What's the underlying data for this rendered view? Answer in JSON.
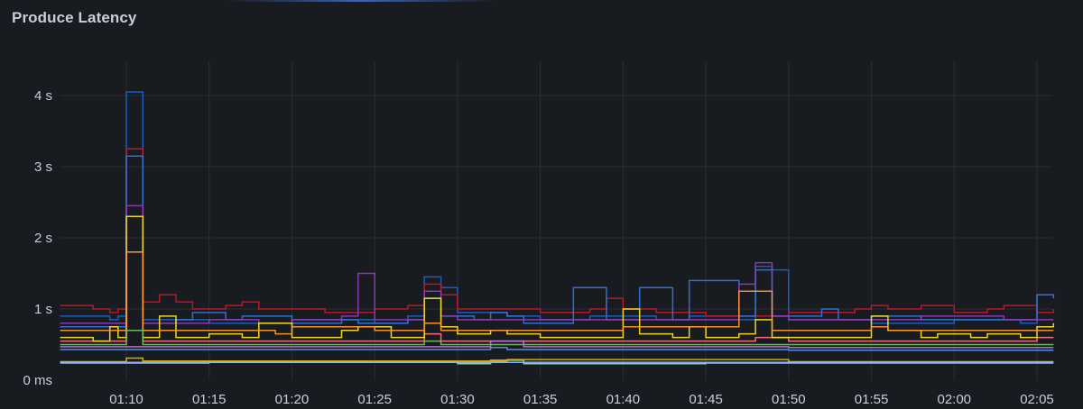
{
  "panel": {
    "title": "Produce Latency"
  },
  "chart_data": {
    "type": "line",
    "title": "Produce Latency",
    "xlabel": "",
    "ylabel": "",
    "x_unit": "time (HH:MM)",
    "y_unit": "seconds",
    "xlim": [
      "01:06",
      "02:06"
    ],
    "ylim": [
      0,
      4.2
    ],
    "x_ticks": [
      "01:10",
      "01:15",
      "01:20",
      "01:25",
      "01:30",
      "01:35",
      "01:40",
      "01:45",
      "01:50",
      "01:55",
      "02:00",
      "02:05"
    ],
    "y_ticks": [
      {
        "value": 0,
        "label": "0 ms"
      },
      {
        "value": 1,
        "label": "1 s"
      },
      {
        "value": 2,
        "label": "2 s"
      },
      {
        "value": 3,
        "label": "3 s"
      },
      {
        "value": 4,
        "label": "4 s"
      }
    ],
    "grid": true,
    "legend": "none",
    "series": [
      {
        "color": "#1f60c4",
        "x": [
          "01:06",
          "01:09",
          "01:09:30",
          "01:10",
          "01:10:30",
          "01:11",
          "01:15",
          "01:20",
          "01:25",
          "01:27",
          "01:28",
          "01:29",
          "01:30",
          "01:33",
          "01:34",
          "01:35",
          "01:37",
          "01:38",
          "01:39",
          "01:42",
          "01:43",
          "01:44",
          "01:47",
          "01:48",
          "01:49",
          "01:50",
          "01:55",
          "02:00",
          "02:04",
          "02:05",
          "02:06"
        ],
        "y": [
          0.9,
          0.85,
          0.9,
          4.05,
          4.05,
          0.85,
          0.8,
          0.85,
          0.8,
          0.9,
          1.45,
          1.3,
          0.95,
          0.9,
          0.9,
          0.85,
          0.85,
          0.9,
          0.9,
          0.85,
          0.85,
          0.9,
          0.85,
          1.6,
          1.55,
          0.85,
          0.8,
          0.85,
          0.8,
          1.2,
          1.15
        ]
      },
      {
        "color": "#c4162a",
        "x": [
          "01:06",
          "01:08",
          "01:09",
          "01:09:30",
          "01:10",
          "01:10:30",
          "01:11",
          "01:12",
          "01:13",
          "01:14",
          "01:16",
          "01:17",
          "01:18",
          "01:22",
          "01:25",
          "01:27",
          "01:28",
          "01:29",
          "01:30",
          "01:35",
          "01:38",
          "01:39",
          "01:40",
          "01:42",
          "01:45",
          "01:50",
          "01:54",
          "01:55",
          "01:56",
          "01:58",
          "02:00",
          "02:02",
          "02:03",
          "02:05",
          "02:06"
        ],
        "y": [
          1.05,
          1.0,
          0.95,
          1.0,
          3.25,
          3.25,
          1.1,
          1.2,
          1.1,
          1.0,
          1.05,
          1.1,
          1.0,
          0.95,
          1.0,
          1.05,
          1.35,
          1.2,
          1.0,
          0.95,
          1.0,
          1.15,
          1.0,
          0.95,
          0.9,
          0.95,
          1.0,
          1.05,
          1.0,
          1.05,
          0.95,
          1.0,
          1.05,
          0.95,
          1.0
        ]
      },
      {
        "color": "#3274d9",
        "x": [
          "01:06",
          "01:09:30",
          "01:10",
          "01:10:30",
          "01:11",
          "01:13",
          "01:14",
          "01:16",
          "01:17",
          "01:20",
          "01:23",
          "01:24",
          "01:27",
          "01:28",
          "01:29",
          "01:31",
          "01:32",
          "01:33",
          "01:34",
          "01:35",
          "01:37",
          "01:38",
          "01:39",
          "01:41",
          "01:42",
          "01:43",
          "01:44",
          "01:45",
          "01:47",
          "01:48",
          "01:49",
          "01:52",
          "01:53",
          "01:55",
          "01:58",
          "02:00",
          "02:04",
          "02:05",
          "02:06"
        ],
        "y": [
          0.75,
          0.75,
          3.15,
          3.15,
          0.8,
          0.85,
          0.95,
          0.85,
          0.9,
          0.8,
          0.85,
          0.8,
          0.85,
          1.15,
          0.9,
          0.85,
          0.95,
          0.9,
          0.8,
          0.8,
          1.3,
          1.3,
          0.85,
          1.3,
          1.3,
          0.85,
          1.4,
          1.4,
          0.9,
          1.55,
          0.9,
          1.0,
          0.85,
          0.9,
          0.85,
          0.85,
          0.85,
          1.2,
          1.15
        ]
      },
      {
        "color": "#8f3bb8",
        "x": [
          "01:06",
          "01:09:30",
          "01:10",
          "01:10:30",
          "01:11",
          "01:15",
          "01:18",
          "01:20",
          "01:23",
          "01:24",
          "01:25",
          "01:27",
          "01:28",
          "01:29",
          "01:30",
          "01:33",
          "01:35",
          "01:40",
          "01:45",
          "01:47",
          "01:48",
          "01:49",
          "01:50",
          "01:55",
          "01:58",
          "02:00",
          "02:03",
          "02:04",
          "02:05",
          "02:06"
        ],
        "y": [
          0.8,
          0.8,
          2.45,
          2.45,
          0.8,
          0.85,
          0.8,
          0.85,
          0.9,
          1.5,
          0.85,
          0.85,
          1.25,
          0.9,
          0.85,
          0.85,
          0.85,
          0.85,
          0.85,
          1.35,
          1.65,
          0.9,
          0.85,
          0.85,
          0.9,
          0.9,
          0.85,
          0.85,
          0.85,
          0.85
        ]
      },
      {
        "color": "#ff7383",
        "x": [
          "01:06",
          "01:09:30",
          "01:10",
          "01:10:30",
          "01:11",
          "01:20",
          "01:28",
          "01:29",
          "01:33",
          "01:40",
          "01:48",
          "01:50",
          "02:05",
          "02:06"
        ],
        "y": [
          0.55,
          0.55,
          1.8,
          1.8,
          0.55,
          0.55,
          0.65,
          0.55,
          0.55,
          0.55,
          0.6,
          0.55,
          0.6,
          0.6
        ]
      },
      {
        "color": "#fade2a",
        "x": [
          "01:06",
          "01:08",
          "01:09",
          "01:09:30",
          "01:10",
          "01:10:30",
          "01:11",
          "01:12",
          "01:13",
          "01:14",
          "01:15",
          "01:17",
          "01:18",
          "01:20",
          "01:22",
          "01:23",
          "01:24",
          "01:26",
          "01:27",
          "01:28",
          "01:29",
          "01:30",
          "01:32",
          "01:33",
          "01:35",
          "01:39",
          "01:40",
          "01:41",
          "01:43",
          "01:44",
          "01:45",
          "01:47",
          "01:48",
          "01:49",
          "01:52",
          "01:54",
          "01:55",
          "01:56",
          "01:58",
          "01:59",
          "02:01",
          "02:02",
          "02:04",
          "02:05",
          "02:06"
        ],
        "y": [
          0.6,
          0.55,
          0.75,
          0.6,
          2.3,
          2.3,
          0.6,
          0.9,
          0.6,
          0.6,
          0.65,
          0.6,
          0.8,
          0.6,
          0.6,
          0.7,
          0.75,
          0.6,
          0.6,
          1.15,
          0.75,
          0.65,
          0.7,
          0.65,
          0.6,
          0.6,
          1.0,
          0.65,
          0.6,
          0.75,
          0.6,
          0.65,
          0.85,
          0.6,
          0.6,
          0.6,
          0.9,
          0.7,
          0.6,
          0.65,
          0.6,
          0.65,
          0.6,
          0.75,
          0.8
        ]
      },
      {
        "color": "#ff9830",
        "x": [
          "01:06",
          "01:09:30",
          "01:10",
          "01:10:30",
          "01:11",
          "01:15",
          "01:19",
          "01:20",
          "01:25",
          "01:28",
          "01:29",
          "01:35",
          "01:39",
          "01:40",
          "01:46",
          "01:47",
          "01:48",
          "01:49",
          "01:55",
          "01:56",
          "02:00",
          "02:06"
        ],
        "y": [
          0.7,
          0.7,
          1.8,
          1.8,
          0.7,
          0.7,
          0.65,
          0.75,
          0.7,
          0.8,
          0.7,
          0.7,
          0.7,
          0.75,
          0.75,
          1.25,
          1.25,
          0.7,
          0.75,
          0.7,
          0.7,
          0.7
        ]
      },
      {
        "color": "#73bf69",
        "x": [
          "01:06",
          "01:09:30",
          "01:10",
          "01:10:30",
          "01:11",
          "01:20",
          "01:28",
          "01:29",
          "01:35",
          "01:40",
          "01:48",
          "01:50",
          "02:05",
          "02:06"
        ],
        "y": [
          0.5,
          0.5,
          0.7,
          0.7,
          0.5,
          0.5,
          0.55,
          0.5,
          0.5,
          0.5,
          0.5,
          0.5,
          0.5,
          0.5
        ]
      },
      {
        "color": "#5794f2",
        "x": [
          "01:06",
          "01:20",
          "01:30",
          "01:32",
          "01:33",
          "01:40",
          "01:50",
          "02:06"
        ],
        "y": [
          0.43,
          0.43,
          0.43,
          0.46,
          0.43,
          0.43,
          0.42,
          0.42
        ]
      },
      {
        "color": "#b877d9",
        "x": [
          "01:06",
          "01:20",
          "01:31",
          "01:32",
          "01:34",
          "01:40",
          "01:50",
          "02:06"
        ],
        "y": [
          0.47,
          0.47,
          0.47,
          0.55,
          0.47,
          0.47,
          0.46,
          0.46
        ]
      },
      {
        "color": "#96d98d",
        "x": [
          "01:06",
          "01:10",
          "01:15",
          "01:25",
          "01:30",
          "01:32",
          "01:34",
          "01:45",
          "01:50",
          "02:00",
          "02:06"
        ],
        "y": [
          0.24,
          0.24,
          0.25,
          0.25,
          0.23,
          0.28,
          0.23,
          0.24,
          0.24,
          0.24,
          0.24
        ]
      },
      {
        "color": "#e0b400",
        "x": [
          "01:06",
          "01:09:30",
          "01:10",
          "01:10:30",
          "01:11",
          "01:20",
          "01:32",
          "01:33",
          "01:50",
          "02:06"
        ],
        "y": [
          0.26,
          0.26,
          0.31,
          0.31,
          0.27,
          0.27,
          0.27,
          0.29,
          0.26,
          0.26
        ]
      },
      {
        "color": "#8ab8ff",
        "x": [
          "01:06",
          "01:20",
          "01:40",
          "01:50",
          "02:06"
        ],
        "y": [
          0.25,
          0.25,
          0.25,
          0.25,
          0.25
        ]
      }
    ]
  }
}
